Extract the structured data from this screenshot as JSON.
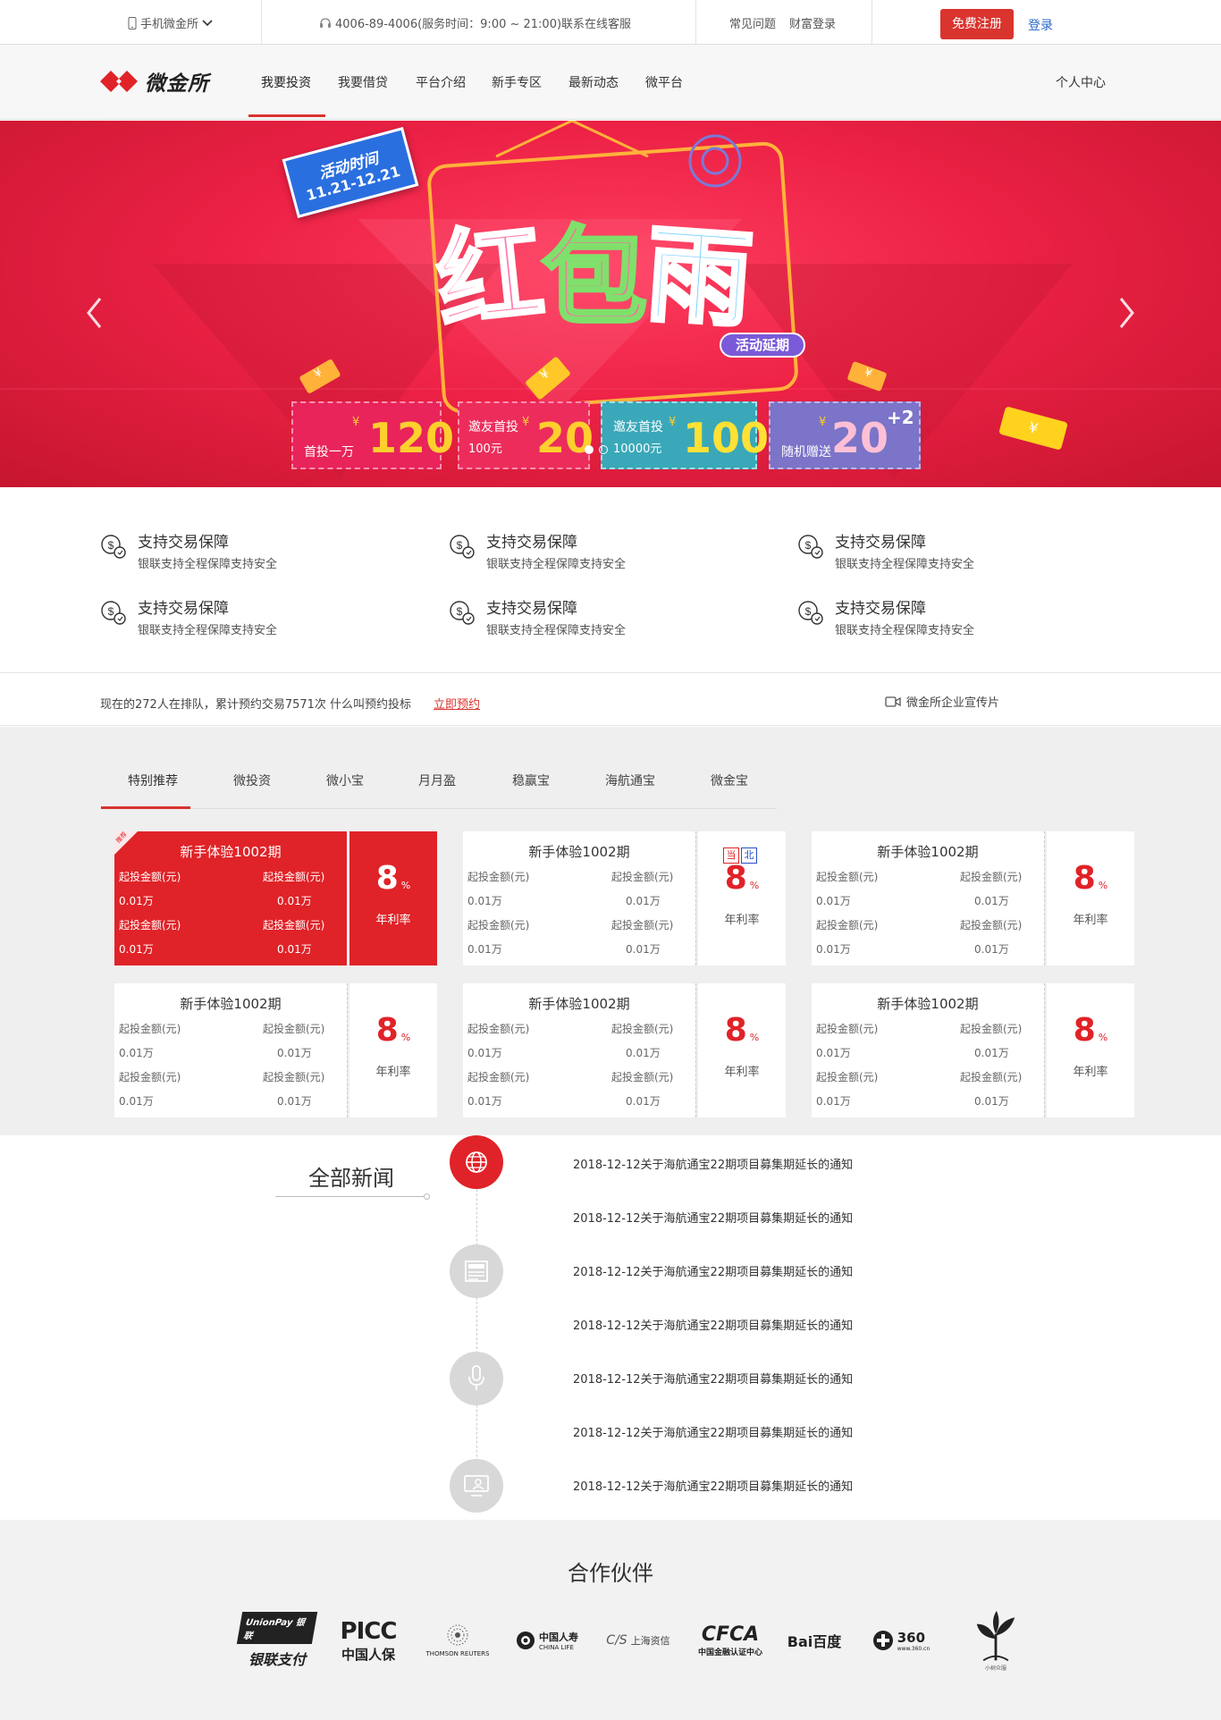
{
  "topbar": {
    "mobile": "手机微金所",
    "hotline": "4006-89-4006(服务时间：9:00 ~ 21:00)联系在线客服",
    "faq": "常见问题",
    "wealth_login": "财富登录",
    "register": "免费注册",
    "login": "登录"
  },
  "nav": {
    "logo": "微金所",
    "items": [
      "我要投资",
      "我要借贷",
      "平台介绍",
      "新手专区",
      "最新动态",
      "微平台"
    ],
    "active_index": 0,
    "user_center": "个人中心"
  },
  "banner": {
    "stamp_line1": "活动时间",
    "stamp_line2": "11.21-12.21",
    "headline": [
      "红",
      "包",
      "雨"
    ],
    "extended": "活动延期",
    "coupons": [
      {
        "label": "首投一万",
        "sub": "",
        "currency": "¥",
        "amount": "120"
      },
      {
        "label": "邀友首投",
        "sub": "100元",
        "currency": "¥",
        "amount": "20"
      },
      {
        "label": "邀友首投",
        "sub": "10000元",
        "currency": "¥",
        "amount": "100"
      },
      {
        "label": "随机赠送",
        "sub": "",
        "currency": "¥",
        "amount": "20",
        "extra": "+2"
      }
    ],
    "slides": 2,
    "active_slide": 0,
    "yen": "¥"
  },
  "features": [
    {
      "title": "支持交易保障",
      "desc": "银联支持全程保障支持安全"
    },
    {
      "title": "支持交易保障",
      "desc": "银联支持全程保障支持安全"
    },
    {
      "title": "支持交易保障",
      "desc": "银联支持全程保障支持安全"
    },
    {
      "title": "支持交易保障",
      "desc": "银联支持全程保障支持安全"
    },
    {
      "title": "支持交易保障",
      "desc": "银联支持全程保障支持安全"
    },
    {
      "title": "支持交易保障",
      "desc": "银联支持全程保障支持安全"
    }
  ],
  "queue": {
    "text": "现在的272人在排队，累计预约交易7571次 什么叫预约投标",
    "link": "立即预约",
    "video": "微金所企业宣传片"
  },
  "products": {
    "tabs": [
      "特别推荐",
      "微投资",
      "微小宝",
      "月月盈",
      "稳赢宝",
      "海航通宝",
      "微金宝"
    ],
    "active_tab": 0,
    "cards": [
      {
        "title": "新手体验1002期",
        "rate": "8",
        "unit": "%",
        "rate_label": "年利率",
        "highlight": true,
        "badge": "推荐",
        "fields": [
          {
            "label": "起投金额(元)",
            "value": "0.01万"
          },
          {
            "label": "起投金额(元)",
            "value": "0.01万"
          },
          {
            "label": "起投金额(元)",
            "value": "0.01万"
          },
          {
            "label": "起投金额(元)",
            "value": "0.01万"
          }
        ]
      },
      {
        "title": "新手体验1002期",
        "rate": "8",
        "unit": "%",
        "rate_label": "年利率",
        "highlight": false,
        "tags": [
          "当",
          "北"
        ],
        "fields": [
          {
            "label": "起投金额(元)",
            "value": "0.01万"
          },
          {
            "label": "起投金额(元)",
            "value": "0.01万"
          },
          {
            "label": "起投金额(元)",
            "value": "0.01万"
          },
          {
            "label": "起投金额(元)",
            "value": "0.01万"
          }
        ]
      },
      {
        "title": "新手体验1002期",
        "rate": "8",
        "unit": "%",
        "rate_label": "年利率",
        "highlight": false,
        "fields": [
          {
            "label": "起投金额(元)",
            "value": "0.01万"
          },
          {
            "label": "起投金额(元)",
            "value": "0.01万"
          },
          {
            "label": "起投金额(元)",
            "value": "0.01万"
          },
          {
            "label": "起投金额(元)",
            "value": "0.01万"
          }
        ]
      },
      {
        "title": "新手体验1002期",
        "rate": "8",
        "unit": "%",
        "rate_label": "年利率",
        "highlight": false,
        "fields": [
          {
            "label": "起投金额(元)",
            "value": "0.01万"
          },
          {
            "label": "起投金额(元)",
            "value": "0.01万"
          },
          {
            "label": "起投金额(元)",
            "value": "0.01万"
          },
          {
            "label": "起投金额(元)",
            "value": "0.01万"
          }
        ]
      },
      {
        "title": "新手体验1002期",
        "rate": "8",
        "unit": "%",
        "rate_label": "年利率",
        "highlight": false,
        "fields": [
          {
            "label": "起投金额(元)",
            "value": "0.01万"
          },
          {
            "label": "起投金额(元)",
            "value": "0.01万"
          },
          {
            "label": "起投金额(元)",
            "value": "0.01万"
          },
          {
            "label": "起投金额(元)",
            "value": "0.01万"
          }
        ]
      },
      {
        "title": "新手体验1002期",
        "rate": "8",
        "unit": "%",
        "rate_label": "年利率",
        "highlight": false,
        "fields": [
          {
            "label": "起投金额(元)",
            "value": "0.01万"
          },
          {
            "label": "起投金额(元)",
            "value": "0.01万"
          },
          {
            "label": "起投金额(元)",
            "value": "0.01万"
          },
          {
            "label": "起投金额(元)",
            "value": "0.01万"
          }
        ]
      }
    ]
  },
  "news": {
    "title": "全部新闻",
    "icons": [
      "globe-icon",
      "newspaper-icon",
      "microphone-icon",
      "monitor-icon"
    ],
    "items": [
      "2018-12-12关于海航通宝22期项目募集期延长的通知",
      "2018-12-12关于海航通宝22期项目募集期延长的通知",
      "2018-12-12关于海航通宝22期项目募集期延长的通知",
      "2018-12-12关于海航通宝22期项目募集期延长的通知",
      "2018-12-12关于海航通宝22期项目募集期延长的通知",
      "2018-12-12关于海航通宝22期项目募集期延长的通知",
      "2018-12-12关于海航通宝22期项目募集期延长的通知"
    ]
  },
  "partners": {
    "title": "合作伙伴",
    "logos": [
      {
        "name": "unionpay-logo",
        "line1": "UnionPay 银联",
        "line2": "银联支付"
      },
      {
        "name": "picc-logo",
        "line1": "PICC",
        "line2": "中国人保"
      },
      {
        "name": "thomson-reuters-logo",
        "line1": "",
        "line2": "THOMSON REUTERS"
      },
      {
        "name": "china-life-logo",
        "line1": "中国人寿",
        "line2": "CHINA LIFE"
      },
      {
        "name": "shanghai-credit-logo",
        "line1": "上海资信",
        "line2": ""
      },
      {
        "name": "cfca-logo",
        "line1": "CFCA",
        "line2": "中国金融认证中心"
      },
      {
        "name": "baidu-logo",
        "line1": "Bai百度",
        "line2": ""
      },
      {
        "name": "360-logo",
        "line1": "360",
        "line2": "www.360.cn"
      },
      {
        "name": "xiaomi-tree-logo",
        "line1": "",
        "line2": "小树众服"
      }
    ]
  },
  "colors": {
    "brand_red": "#d9342e",
    "card_red": "#e02328",
    "link_blue": "#2a68c9"
  }
}
